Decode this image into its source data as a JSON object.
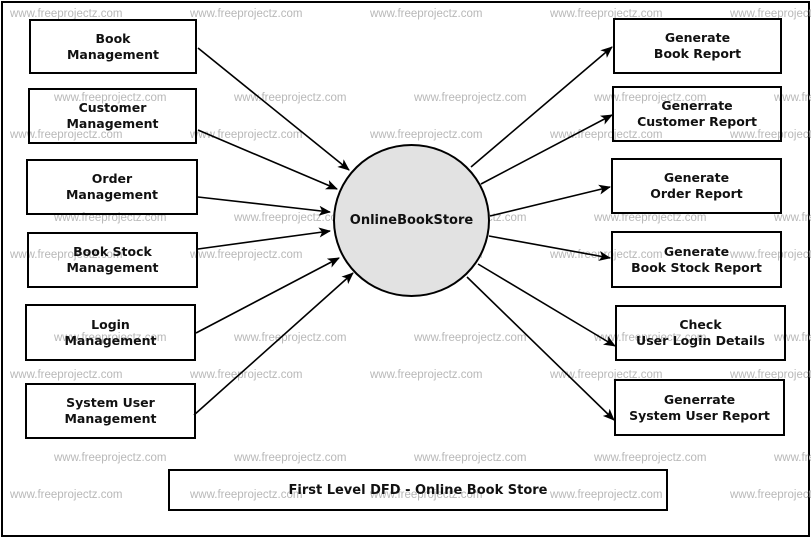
{
  "diagram": {
    "type": "Data Flow Diagram",
    "title": "First Level DFD - Online Book Store",
    "central_process": {
      "lines": [
        "Online",
        "Book",
        "Store"
      ]
    },
    "inputs": [
      {
        "id": "book-management",
        "lines": [
          "Book",
          "Management"
        ]
      },
      {
        "id": "customer-management",
        "lines": [
          "Customer",
          "Management"
        ]
      },
      {
        "id": "order-management",
        "lines": [
          "Order",
          "Management"
        ]
      },
      {
        "id": "book-stock-management",
        "lines": [
          "Book Stock",
          "Management"
        ]
      },
      {
        "id": "login-management",
        "lines": [
          "Login",
          "Management"
        ]
      },
      {
        "id": "system-user-management",
        "lines": [
          "System User",
          "Management"
        ]
      }
    ],
    "outputs": [
      {
        "id": "generate-book-report",
        "lines": [
          "Generate",
          "Book Report"
        ]
      },
      {
        "id": "generate-customer-report",
        "lines": [
          "Generrate",
          "Customer Report"
        ]
      },
      {
        "id": "generate-order-report",
        "lines": [
          "Generate",
          "Order Report"
        ]
      },
      {
        "id": "generate-book-stock-report",
        "lines": [
          "Generate",
          "Book Stock Report"
        ]
      },
      {
        "id": "check-user-login-details",
        "lines": [
          "Check",
          "User Login Details"
        ]
      },
      {
        "id": "generate-system-user-report",
        "lines": [
          "Generrate",
          "System User Report"
        ]
      }
    ],
    "flows": [
      {
        "from": "book-management",
        "to": "central"
      },
      {
        "from": "customer-management",
        "to": "central"
      },
      {
        "from": "order-management",
        "to": "central"
      },
      {
        "from": "book-stock-management",
        "to": "central"
      },
      {
        "from": "login-management",
        "to": "central"
      },
      {
        "from": "system-user-management",
        "to": "central"
      },
      {
        "from": "central",
        "to": "generate-book-report"
      },
      {
        "from": "central",
        "to": "generate-customer-report"
      },
      {
        "from": "central",
        "to": "generate-order-report"
      },
      {
        "from": "central",
        "to": "generate-book-stock-report"
      },
      {
        "from": "central",
        "to": "check-user-login-details"
      },
      {
        "from": "central",
        "to": "generate-system-user-report"
      }
    ],
    "watermark": "www.freeprojectz.com",
    "colors": {
      "process_fill": "#e2e2e2",
      "stroke": "#000000",
      "watermark": "#b8b8b8"
    }
  }
}
